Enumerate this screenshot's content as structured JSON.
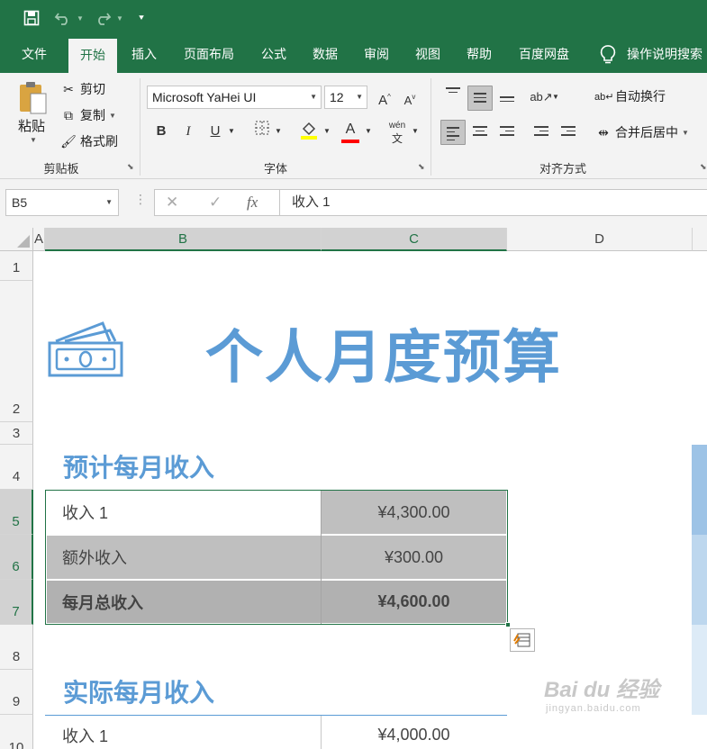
{
  "tabs": [
    {
      "label": "文件",
      "active": false
    },
    {
      "label": "开始",
      "active": true
    },
    {
      "label": "插入",
      "active": false
    },
    {
      "label": "页面布局",
      "active": false
    },
    {
      "label": "公式",
      "active": false
    },
    {
      "label": "数据",
      "active": false
    },
    {
      "label": "审阅",
      "active": false
    },
    {
      "label": "视图",
      "active": false
    },
    {
      "label": "帮助",
      "active": false
    },
    {
      "label": "百度网盘",
      "active": false
    }
  ],
  "tell_me": "操作说明搜索",
  "clipboard": {
    "paste": "粘贴",
    "cut": "剪切",
    "copy": "复制",
    "format_painter": "格式刷",
    "group": "剪贴板"
  },
  "font": {
    "name": "Microsoft YaHei UI",
    "size": "12",
    "group": "字体",
    "bold": "B",
    "italic": "I",
    "underline": "U",
    "grow": "A",
    "shrink": "A",
    "phonetic": "wén",
    "font_color": "A",
    "fill_color_hex": "#ffff00",
    "font_color_hex": "#ff0000"
  },
  "alignment": {
    "wrap_text": "自动换行",
    "merge_center": "合并后居中",
    "group": "对齐方式"
  },
  "formula_bar": {
    "name_box": "B5",
    "cancel": "✕",
    "enter": "✓",
    "fx": "fx",
    "content": "收入 1"
  },
  "columns": [
    "A",
    "B",
    "C",
    "D"
  ],
  "rows": [
    "1",
    "2",
    "3",
    "4",
    "5",
    "6",
    "7",
    "8",
    "9",
    "10"
  ],
  "sheet": {
    "title": "个人月度预算",
    "section1": {
      "heading": "预计每月收入",
      "rows": [
        {
          "label": "收入 1",
          "value": "¥4,300.00"
        },
        {
          "label": "额外收入",
          "value": "¥300.00"
        },
        {
          "label": "每月总收入",
          "value": "¥4,600.00"
        }
      ]
    },
    "section2": {
      "heading": "实际每月收入",
      "rows": [
        {
          "label": "收入 1",
          "value": "¥4,000.00"
        }
      ]
    }
  },
  "watermark": {
    "main": "Bai du 经验",
    "sub": "jingyan.baidu.com"
  },
  "colors": {
    "excel_green": "#217346",
    "accent_blue": "#5b9bd5",
    "selected_fill": "#bfbfbf"
  }
}
